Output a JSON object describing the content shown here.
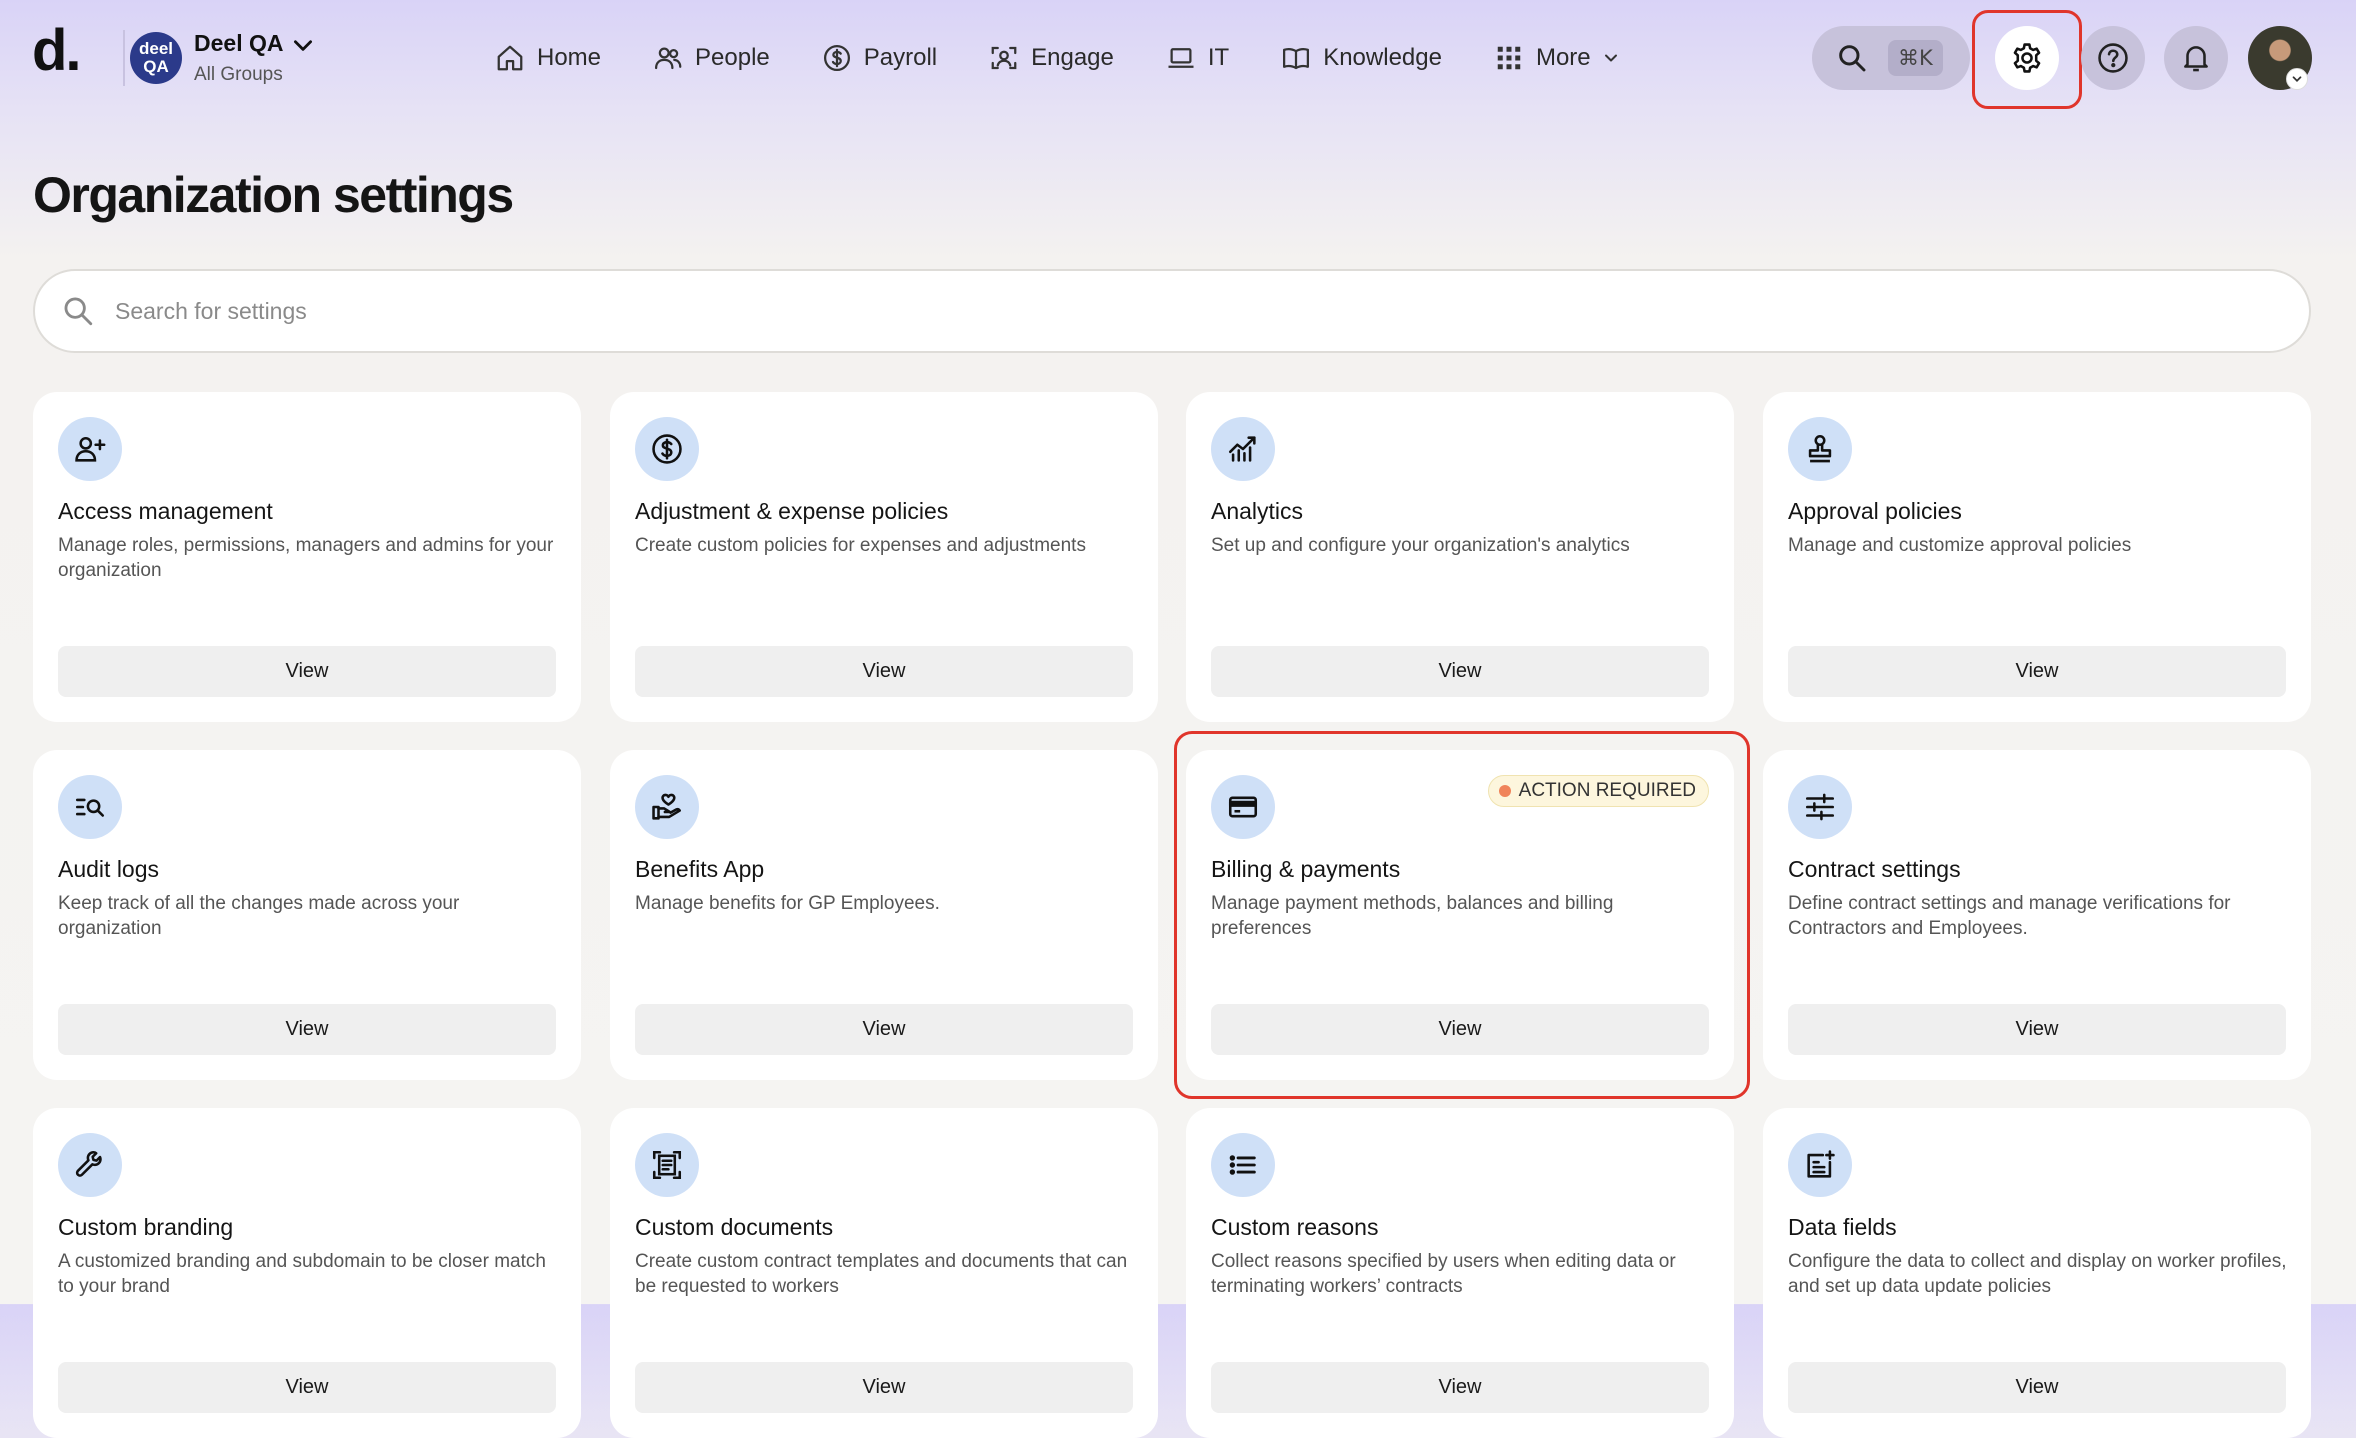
{
  "header": {
    "logo": "d.",
    "org_avatar_line1": "deel",
    "org_avatar_line2": "QA",
    "org_name": "Deel QA",
    "org_subtitle": "All Groups",
    "nav": [
      {
        "label": "Home",
        "icon": "home-icon"
      },
      {
        "label": "People",
        "icon": "people-icon"
      },
      {
        "label": "Payroll",
        "icon": "dollar-circle-icon"
      },
      {
        "label": "Engage",
        "icon": "engage-icon"
      },
      {
        "label": "IT",
        "icon": "laptop-icon"
      },
      {
        "label": "Knowledge",
        "icon": "book-icon"
      },
      {
        "label": "More",
        "icon": "grid-icon"
      }
    ],
    "search_shortcut": "⌘K"
  },
  "page": {
    "title": "Organization settings",
    "search_placeholder": "Search for settings"
  },
  "cards": [
    {
      "title": "Access management",
      "desc": "Manage roles, permissions, managers and admins for your organization",
      "button": "View",
      "icon": "user-add-icon"
    },
    {
      "title": "Adjustment & expense policies",
      "desc": "Create custom policies for expenses and adjustments",
      "button": "View",
      "icon": "dollar-circle-icon"
    },
    {
      "title": "Analytics",
      "desc": "Set up and configure your organization's analytics",
      "button": "View",
      "icon": "analytics-chart-icon"
    },
    {
      "title": "Approval policies",
      "desc": "Manage and customize approval policies",
      "button": "View",
      "icon": "stamp-icon"
    },
    {
      "title": "Audit logs",
      "desc": "Keep track of all the changes made across your organization",
      "button": "View",
      "icon": "audit-search-icon"
    },
    {
      "title": "Benefits App",
      "desc": "Manage benefits for GP Employees.",
      "button": "View",
      "icon": "hand-heart-icon"
    },
    {
      "title": "Billing & payments",
      "desc": "Manage payment methods, balances and billing preferences",
      "button": "View",
      "icon": "credit-card-icon",
      "badge": "ACTION REQUIRED"
    },
    {
      "title": "Contract settings",
      "desc": "Define contract settings and manage verifications for Contractors and Employees.",
      "button": "View",
      "icon": "sliders-icon"
    },
    {
      "title": "Custom branding",
      "desc": "A customized branding and subdomain to be closer match to your brand",
      "button": "View",
      "icon": "wrench-icon"
    },
    {
      "title": "Custom documents",
      "desc": "Create custom contract templates and documents that can be requested to workers",
      "button": "View",
      "icon": "document-icon"
    },
    {
      "title": "Custom reasons",
      "desc": "Collect reasons specified by users when editing data or terminating workers’ contracts",
      "button": "View",
      "icon": "list-icon"
    },
    {
      "title": "Data fields",
      "desc": "Configure the data to collect and display on worker profiles, and set up data update policies",
      "button": "View",
      "icon": "data-fields-icon"
    }
  ]
}
